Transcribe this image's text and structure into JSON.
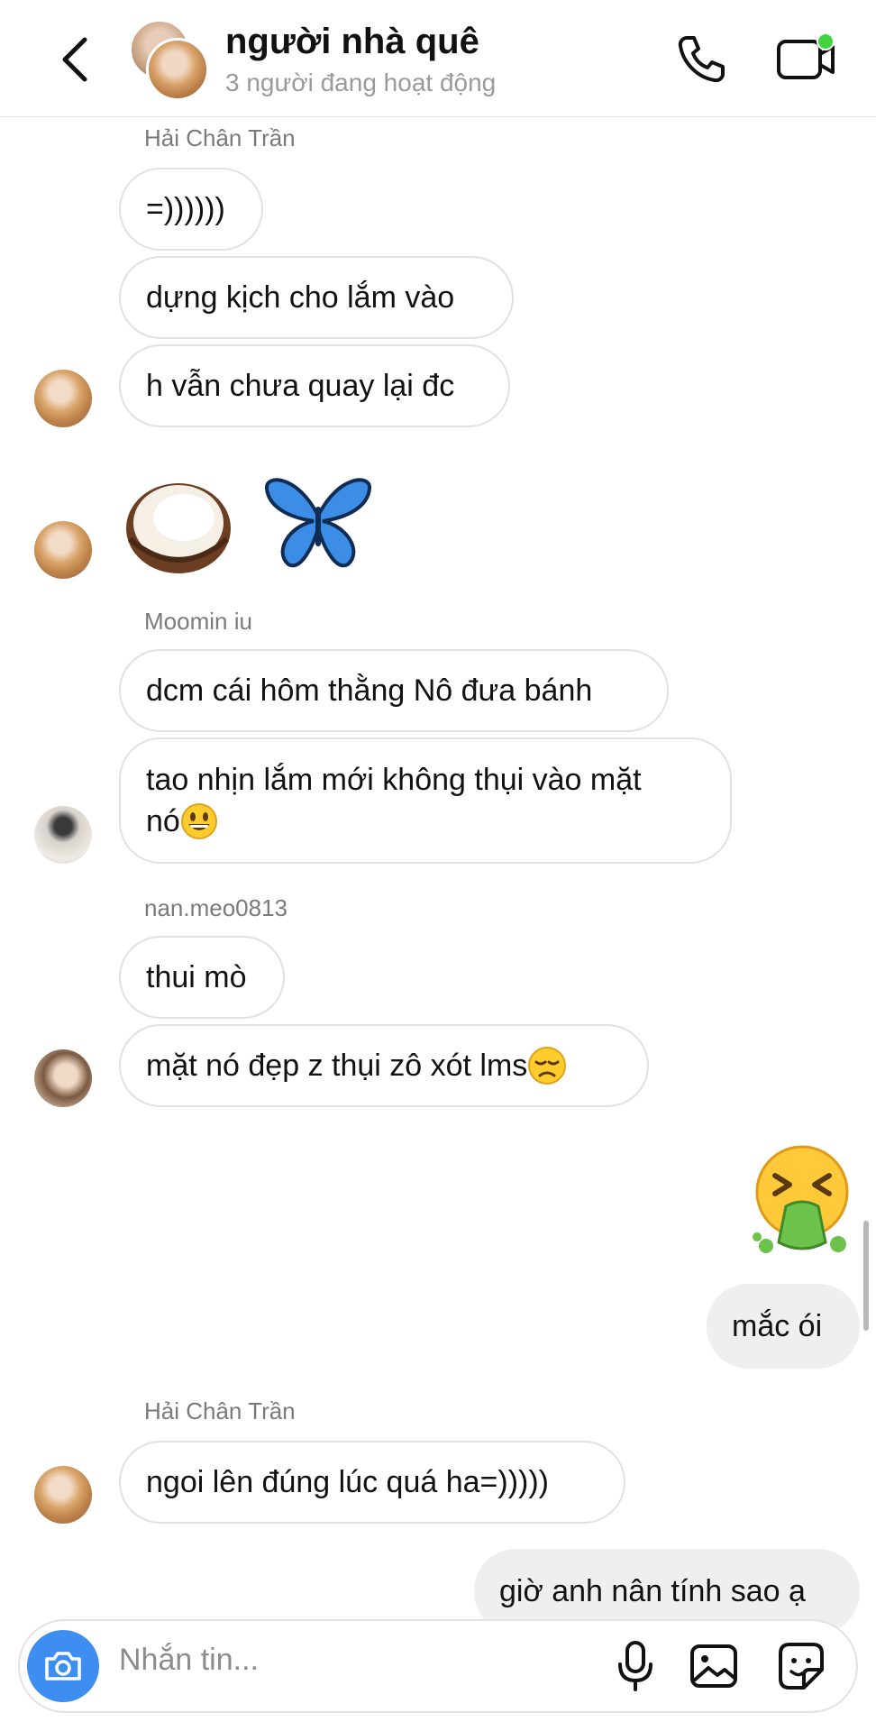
{
  "header": {
    "title": "người nhà quê",
    "subtitle": "3 người đang hoạt động"
  },
  "messages": [
    {
      "sender": "Hải Chân Trần",
      "texts": [
        "=))))))",
        "dựng kịch cho lắm vào",
        "h vẫn chưa quay lại đc"
      ]
    },
    {
      "sender": "Moomin iu",
      "texts": [
        "dcm cái hôm thằng Nô đưa bánh",
        "tao nhịn lắm mới không thụi vào mặt",
        "nó"
      ]
    },
    {
      "sender": "nan.meo0813",
      "texts": [
        "thui mò",
        "mặt nó đẹp z thụi zô xót lms"
      ]
    },
    {
      "outgoing": [
        "mắc ói"
      ]
    },
    {
      "sender": "Hải Chân Trần",
      "texts": [
        "ngoi lên đúng lúc quá ha=)))))"
      ]
    },
    {
      "outgoing": [
        "giờ anh nân tính sao ạ"
      ]
    }
  ],
  "input": {
    "placeholder": "Nhắn tin..."
  },
  "icons": {
    "back": "chevron-left-icon",
    "call": "phone-icon",
    "video": "video-camera-icon",
    "camera": "camera-icon",
    "mic": "microphone-icon",
    "gallery": "image-icon",
    "sticker": "sticker-icon"
  },
  "colors": {
    "accent_blue": "#3d8ef0",
    "online_green": "#3fd33f",
    "outgoing_bubble": "#efefef",
    "sender_name": "#7a7a7a"
  }
}
